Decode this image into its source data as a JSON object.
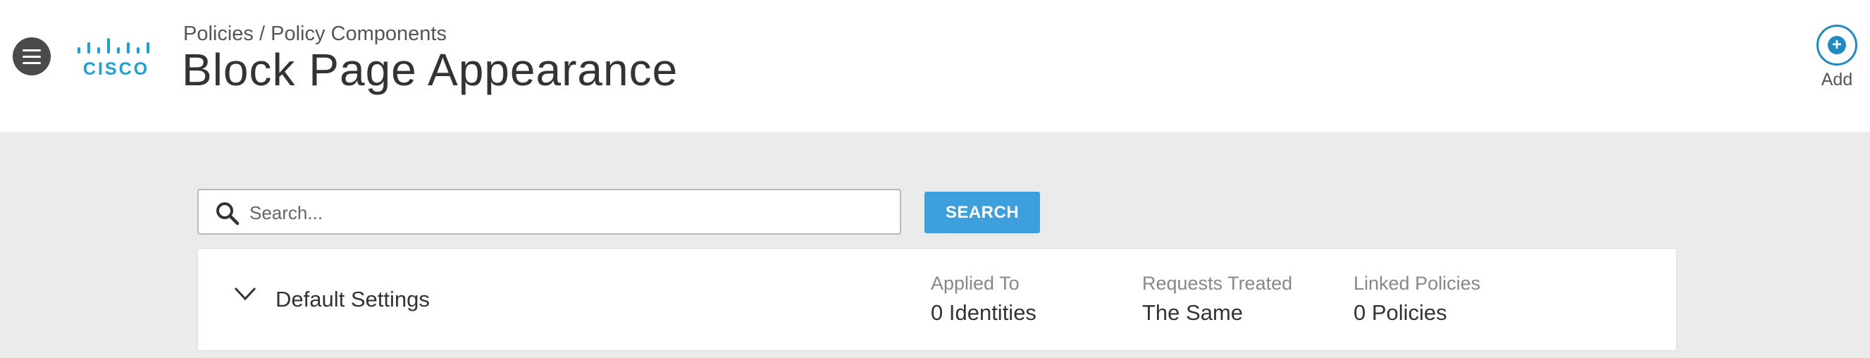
{
  "header": {
    "breadcrumb": [
      "Policies",
      "Policy Components"
    ],
    "breadcrumb_separator": " / ",
    "title": "Block Page Appearance",
    "logo_text": "CISCO",
    "add_label": "Add"
  },
  "search": {
    "placeholder": "Search...",
    "button_label": "SEARCH"
  },
  "settings_row": {
    "title": "Default Settings",
    "stats": [
      {
        "label": "Applied To",
        "value": "0 Identities"
      },
      {
        "label": "Requests Treated",
        "value": "The Same"
      },
      {
        "label": "Linked Policies",
        "value": "0 Policies"
      }
    ]
  },
  "colors": {
    "brand": "#1ba0d7",
    "accent": "#3d9fdb",
    "background": "#ebebeb"
  },
  "icons": {
    "menu": "hamburger-icon",
    "search": "magnifier-icon",
    "add": "plus-circle-icon",
    "expand": "chevron-down-icon"
  }
}
